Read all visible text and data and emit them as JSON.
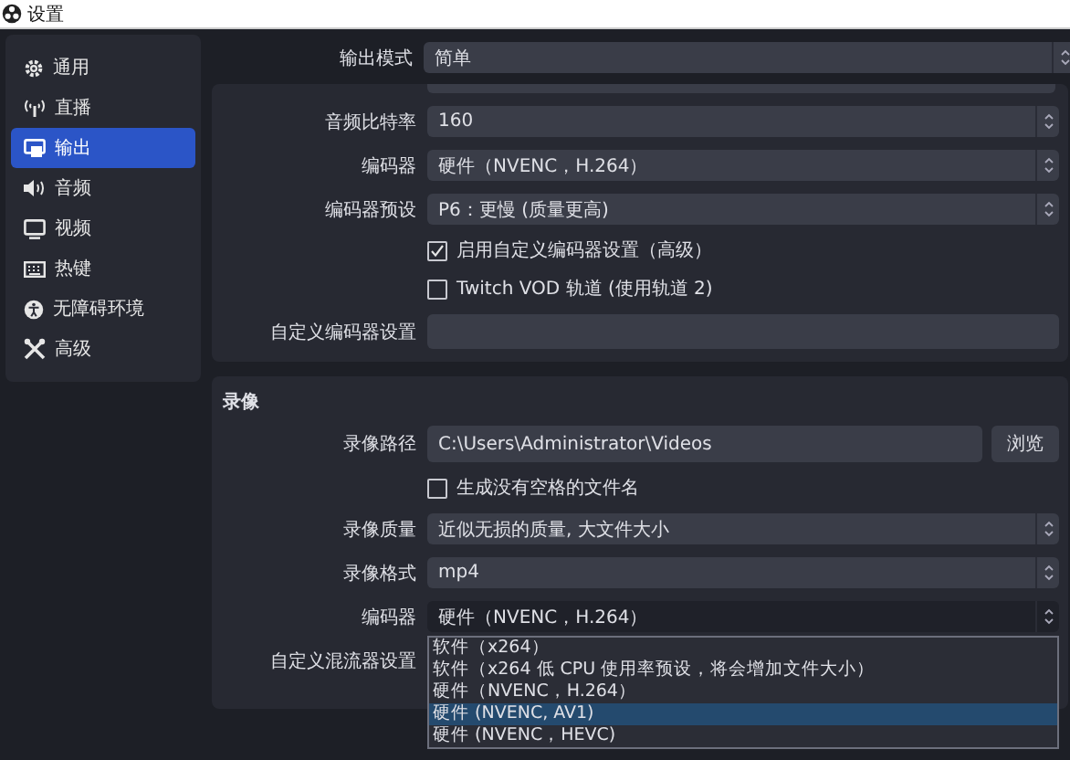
{
  "window": {
    "title": "设置"
  },
  "sidebar": {
    "items": [
      {
        "label": "通用",
        "selected": false
      },
      {
        "label": "直播",
        "selected": false
      },
      {
        "label": "输出",
        "selected": true
      },
      {
        "label": "音频",
        "selected": false
      },
      {
        "label": "视频",
        "selected": false
      },
      {
        "label": "热键",
        "selected": false
      },
      {
        "label": "无障碍环境",
        "selected": false
      },
      {
        "label": "高级",
        "selected": false
      }
    ]
  },
  "output_mode": {
    "label": "输出模式",
    "value": "简单"
  },
  "streaming": {
    "rows": [
      {
        "kind": "spin",
        "label": "音频比特率",
        "value": "160"
      },
      {
        "kind": "select",
        "label": "编码器",
        "value": "硬件（NVENC，H.264）"
      },
      {
        "kind": "select",
        "label": "编码器预设",
        "value": "P6：更慢 (质量更高)"
      },
      {
        "kind": "checkbox",
        "label": "启用自定义编码器设置（高级）",
        "checked": true
      },
      {
        "kind": "checkbox",
        "label": "Twitch VOD 轨道 (使用轨道 2)",
        "checked": false
      },
      {
        "kind": "text",
        "label": "自定义编码器设置"
      }
    ]
  },
  "recording": {
    "title": "录像",
    "rows": [
      {
        "kind": "path",
        "label": "录像路径",
        "value": "C:\\Users\\Administrator\\Videos",
        "button": "浏览"
      },
      {
        "kind": "checkbox",
        "label": "生成没有空格的文件名",
        "checked": false
      },
      {
        "kind": "select",
        "label": "录像质量",
        "value": "近似无损的质量, 大文件大小"
      },
      {
        "kind": "select",
        "label": "录像格式",
        "value": "mp4"
      },
      {
        "kind": "select",
        "label": "编码器",
        "value": "硬件（NVENC，H.264）",
        "open": true,
        "options": [
          {
            "label": "软件（x264）",
            "highlighted": false
          },
          {
            "label": "软件（x264 低 CPU 使用率预设，将会增加文件大小）",
            "highlighted": false
          },
          {
            "label": "硬件（NVENC，H.264）",
            "highlighted": false
          },
          {
            "label": "硬件 (NVENC, AV1)",
            "highlighted": true
          },
          {
            "label": "硬件 (NVENC，HEVC)",
            "highlighted": false
          }
        ]
      },
      {
        "kind": "label",
        "label": "自定义混流器设置"
      }
    ]
  }
}
